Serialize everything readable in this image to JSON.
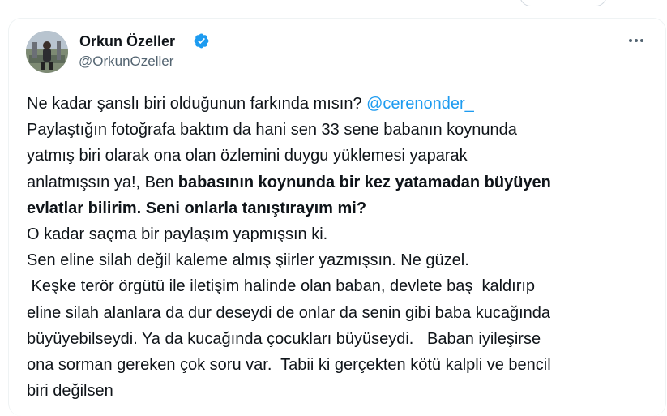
{
  "author": {
    "name": "Orkun Özeller",
    "handle": "@OrkunOzeller",
    "verified": true,
    "badge_color": "#1d9bf0"
  },
  "icons": {
    "verified": "verified-badge-icon",
    "more": "more-options-icon"
  },
  "tweet": {
    "l1_text": "Ne kadar şanslı biri olduğunun farkında mısın? ",
    "l1_mention": "@cerenonder_",
    "l2": "Paylaştığın fotoğrafa baktım da hani sen 33 sene babanın koynunda",
    "l3": "yatmış biri olarak ona olan özlemini duygu yüklemesi yaparak",
    "l4_normal": "anlatmışsın ya!, Ben ",
    "l4_bold": "babasının koynunda bir kez yatamadan büyüyen",
    "l5_bold": "evlatlar bilirim. Seni onlarla tanıştırayım mi?",
    "l6": "O kadar  saçma bir paylaşım yapmışsın ki.",
    "l7": "Sen eline silah değil kaleme almış şiirler yazmışsın.  Ne güzel.",
    "l8": " Keşke terör örgütü ile iletişim halinde olan baban, devlete baş  kaldırıp",
    "l9": "eline silah alanlara da dur deseydi de onlar da senin gibi baba kucağında",
    "l10": "büyüyebilseydi. Ya da kucağında çocukları büyüseydi.   Baban iyileşirse",
    "l11": "ona sorman gereken çok soru var.  Tabii ki gerçekten kötü kalpli ve bencil",
    "l12": "biri değilsen"
  },
  "colors": {
    "text": "#0f1419",
    "secondary": "#536471",
    "link": "#1d9bf0",
    "border": "#eff3f4"
  }
}
